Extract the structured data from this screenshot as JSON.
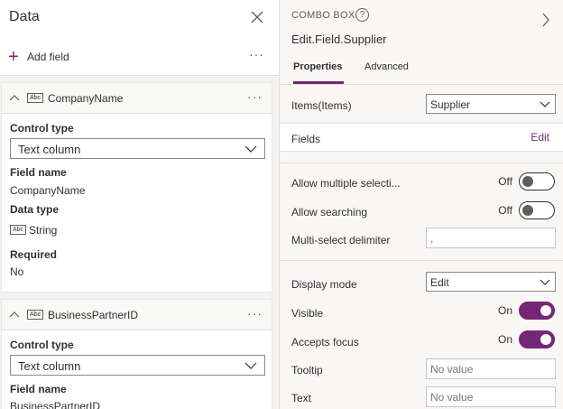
{
  "data_panel": {
    "title": "Data",
    "add_field_label": "Add field",
    "more_label": "···",
    "cards": [
      {
        "field_display_name": "CompanyName",
        "control_type_label": "Control type",
        "control_type_value": "Text column",
        "field_name_label": "Field name",
        "field_name_value": "CompanyName",
        "data_type_label": "Data type",
        "data_type_icon_text": "Abc",
        "data_type_value": "String",
        "required_label": "Required",
        "required_value": "No"
      },
      {
        "field_display_name": "BusinessPartnerID",
        "control_type_label": "Control type",
        "control_type_value": "Text column",
        "field_name_label": "Field name",
        "field_name_value": "BusinessPartnerID"
      }
    ],
    "abc_icon_text": "Abc"
  },
  "properties_panel": {
    "kind": "COMBO BOX",
    "help_glyph": "?",
    "control_name": "Edit.Field.Supplier",
    "tabs": [
      {
        "label": "Properties",
        "active": true
      },
      {
        "label": "Advanced",
        "active": false
      }
    ],
    "items_label": "Items(Items)",
    "items_value": "Supplier",
    "fields_label": "Fields",
    "fields_edit": "Edit",
    "allow_multiple_label": "Allow multiple selecti...",
    "allow_multiple_state": "Off",
    "allow_searching_label": "Allow searching",
    "allow_searching_state": "Off",
    "delimiter_label": "Multi-select delimiter",
    "delimiter_value": ",",
    "display_mode_label": "Display mode",
    "display_mode_value": "Edit",
    "visible_label": "Visible",
    "visible_state": "On",
    "accepts_focus_label": "Accepts focus",
    "accepts_focus_state": "On",
    "tooltip_label": "Tooltip",
    "tooltip_placeholder": "No value",
    "text_label": "Text",
    "text_placeholder": "No value"
  },
  "colors": {
    "accent": "#742774",
    "panel_bg": "#f3f2f1",
    "border": "#e1dfdd"
  }
}
